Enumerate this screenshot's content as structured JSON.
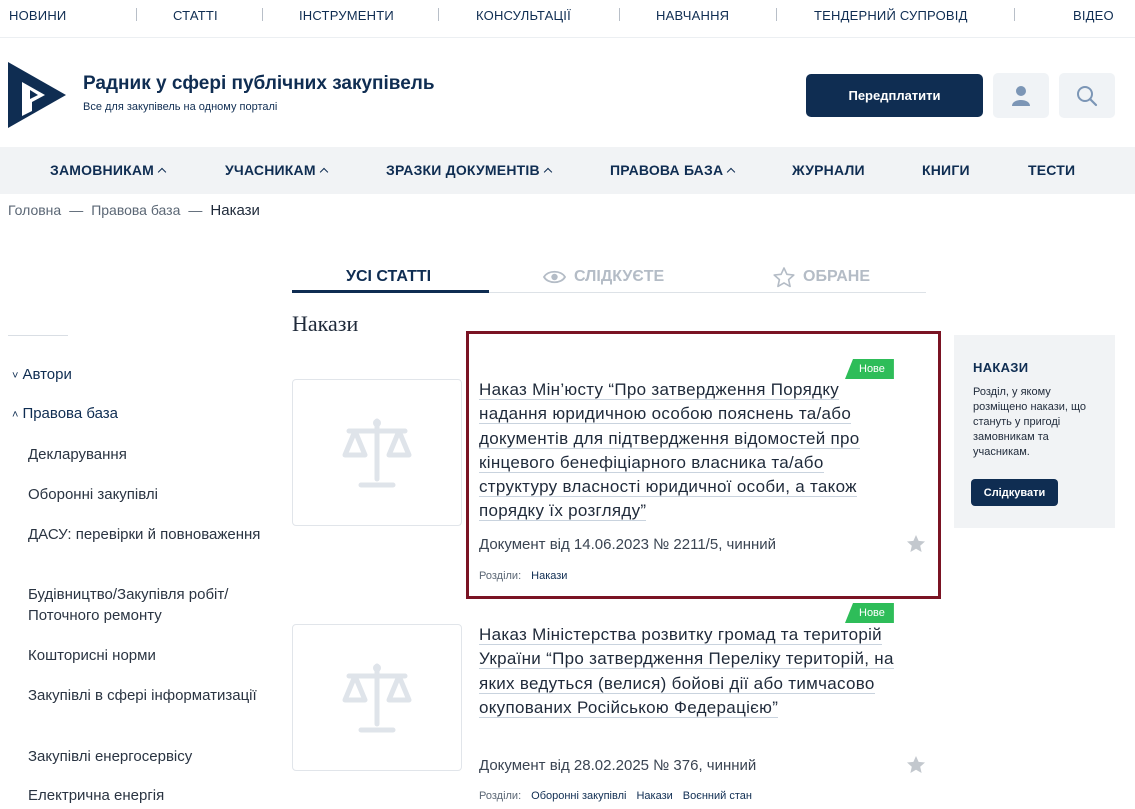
{
  "top_nav": [
    "НОВИНИ",
    "СТАТТІ",
    "ІНСТРУМЕНТИ",
    "КОНСУЛЬТАЦІЇ",
    "НАВЧАННЯ",
    "ТЕНДЕРНИЙ СУПРОВІД",
    "ВІДЕО"
  ],
  "brand": {
    "title": "Радник у сфері публічних закупівель",
    "subtitle": "Все для закупівель на одному порталі",
    "subscribe_label": "Передплатити"
  },
  "main_nav": [
    "ЗАМОВНИКАМ",
    "УЧАСНИКАМ",
    "ЗРАЗКИ ДОКУМЕНТІВ",
    "ПРАВОВА БАЗА",
    "ЖУРНАЛИ",
    "КНИГИ",
    "ТЕСТИ"
  ],
  "breadcrumb": [
    "Головна",
    "Правова база",
    "Накази"
  ],
  "tabs": [
    "УСІ СТАТТІ",
    "СЛІДКУЄТЕ",
    "ОБРАНЕ"
  ],
  "page_title": "Накази",
  "sidebar": {
    "groups": [
      "Автори",
      "Правова база"
    ],
    "items": [
      "Декларування",
      "Оборонні закупівлі",
      "ДАСУ: перевірки й повноваження",
      "Будівництво/Закупівля робіт/ Поточного ремонту",
      "Кошторисні норми",
      "Закупівлі в сфері інформатизації",
      "Закупівлі енергосервісу",
      "Електрична енергія"
    ]
  },
  "articles": [
    {
      "badge": "Нове",
      "title": "Наказ Мін’юсту “Про затвердження Порядку надання юридичною особою пояснень та/або документів для підтвердження відомостей про кінцевого бенефіціарного власника та/або структуру власності юридичної особи, а також порядку їх розгляду”",
      "meta": "Документ від 14.06.2023 № 2211/5, чинний",
      "sections_label": "Розділи:",
      "sections": [
        "Накази"
      ]
    },
    {
      "badge": "Нове",
      "title": "Наказ Міністерства розвитку громад та територій України “Про затвердження Переліку територій, на яких ведуться (велися) бойові дії або тимчасово окупованих Російською Федерацією”",
      "meta": "Документ від 28.02.2025 № 376, чинний",
      "sections_label": "Розділи:",
      "sections": [
        "Оборонні закупівлі",
        "Накази",
        "Воєнний стан"
      ]
    }
  ],
  "panel": {
    "title": "НАКАЗИ",
    "description": "Розділ, у якому розміщено накази, що стануть у пригоді замовникам та учасникам.",
    "follow_label": "Слідкувати"
  },
  "colors": {
    "brand_navy": "#0f2d52",
    "badge_green": "#2ebd59",
    "highlight_border": "#7a1323"
  },
  "icons": [
    "logo-icon",
    "user-icon",
    "search-icon",
    "eye-icon",
    "star-icon",
    "scales-icon"
  ]
}
